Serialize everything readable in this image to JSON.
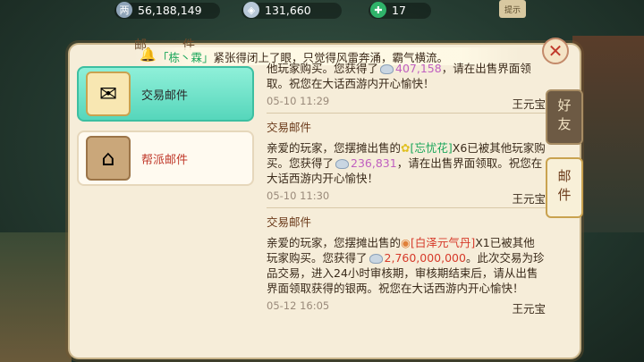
{
  "currencies": [
    {
      "icon": "tael-icon",
      "symbol": "两",
      "value": "56,188,149",
      "color": "#8fa4b8"
    },
    {
      "icon": "silver-icon",
      "symbol": "◈",
      "value": "131,660",
      "color": "#b8c8d8"
    },
    {
      "icon": "jade-icon",
      "symbol": "✚",
      "value": "17",
      "color": "#2fb36a"
    }
  ],
  "settings_label": "提示",
  "panel": {
    "title_chars": "邮件"
  },
  "marquee": {
    "who": "「栋丶霖」",
    "text": "紧张得闭上了眼，只觉得风雷奔涌，霸气横流。"
  },
  "categories": [
    {
      "label": "交易邮件",
      "icon": "trade-mail-icon",
      "glyph": "✉",
      "active": true
    },
    {
      "label": "帮派邮件",
      "icon": "guild-mail-icon",
      "glyph": "⌂",
      "active": false
    }
  ],
  "mails": [
    {
      "subject": "",
      "body_parts": [
        "他玩家购买。您获得了",
        "407,158",
        "，请在出售界面领取。祝您在大话西游内开心愉快！"
      ],
      "date": "05-10 11:29",
      "sender": "王元宝"
    },
    {
      "subject": "交易邮件",
      "body_pre": "亲爱的玩家，您摆摊出售的",
      "item": "[忘忧花]",
      "item_after": "X6已被其他玩家购买。您获得了",
      "money": "236,831",
      "body_post": "，请在出售界面领取。祝您在大话西游内开心愉快！",
      "date": "05-10 11:30",
      "sender": "王元宝"
    },
    {
      "subject": "交易邮件",
      "body_pre": "亲爱的玩家，您摆摊出售的",
      "item": "[白泽元气丹]",
      "item_after": "X1已被其他玩家购买。您获得了",
      "money": "2,760,000,000",
      "body_post": "。此次交易为珍品交易，进入24小时审核期，审核期结束后，请从出售界面领取获得的银两。祝您在大话西游内开心愉快！",
      "date": "05-12 16:05",
      "sender": "王元宝"
    }
  ],
  "tabs": {
    "friends": "好友",
    "mail": "邮件"
  }
}
